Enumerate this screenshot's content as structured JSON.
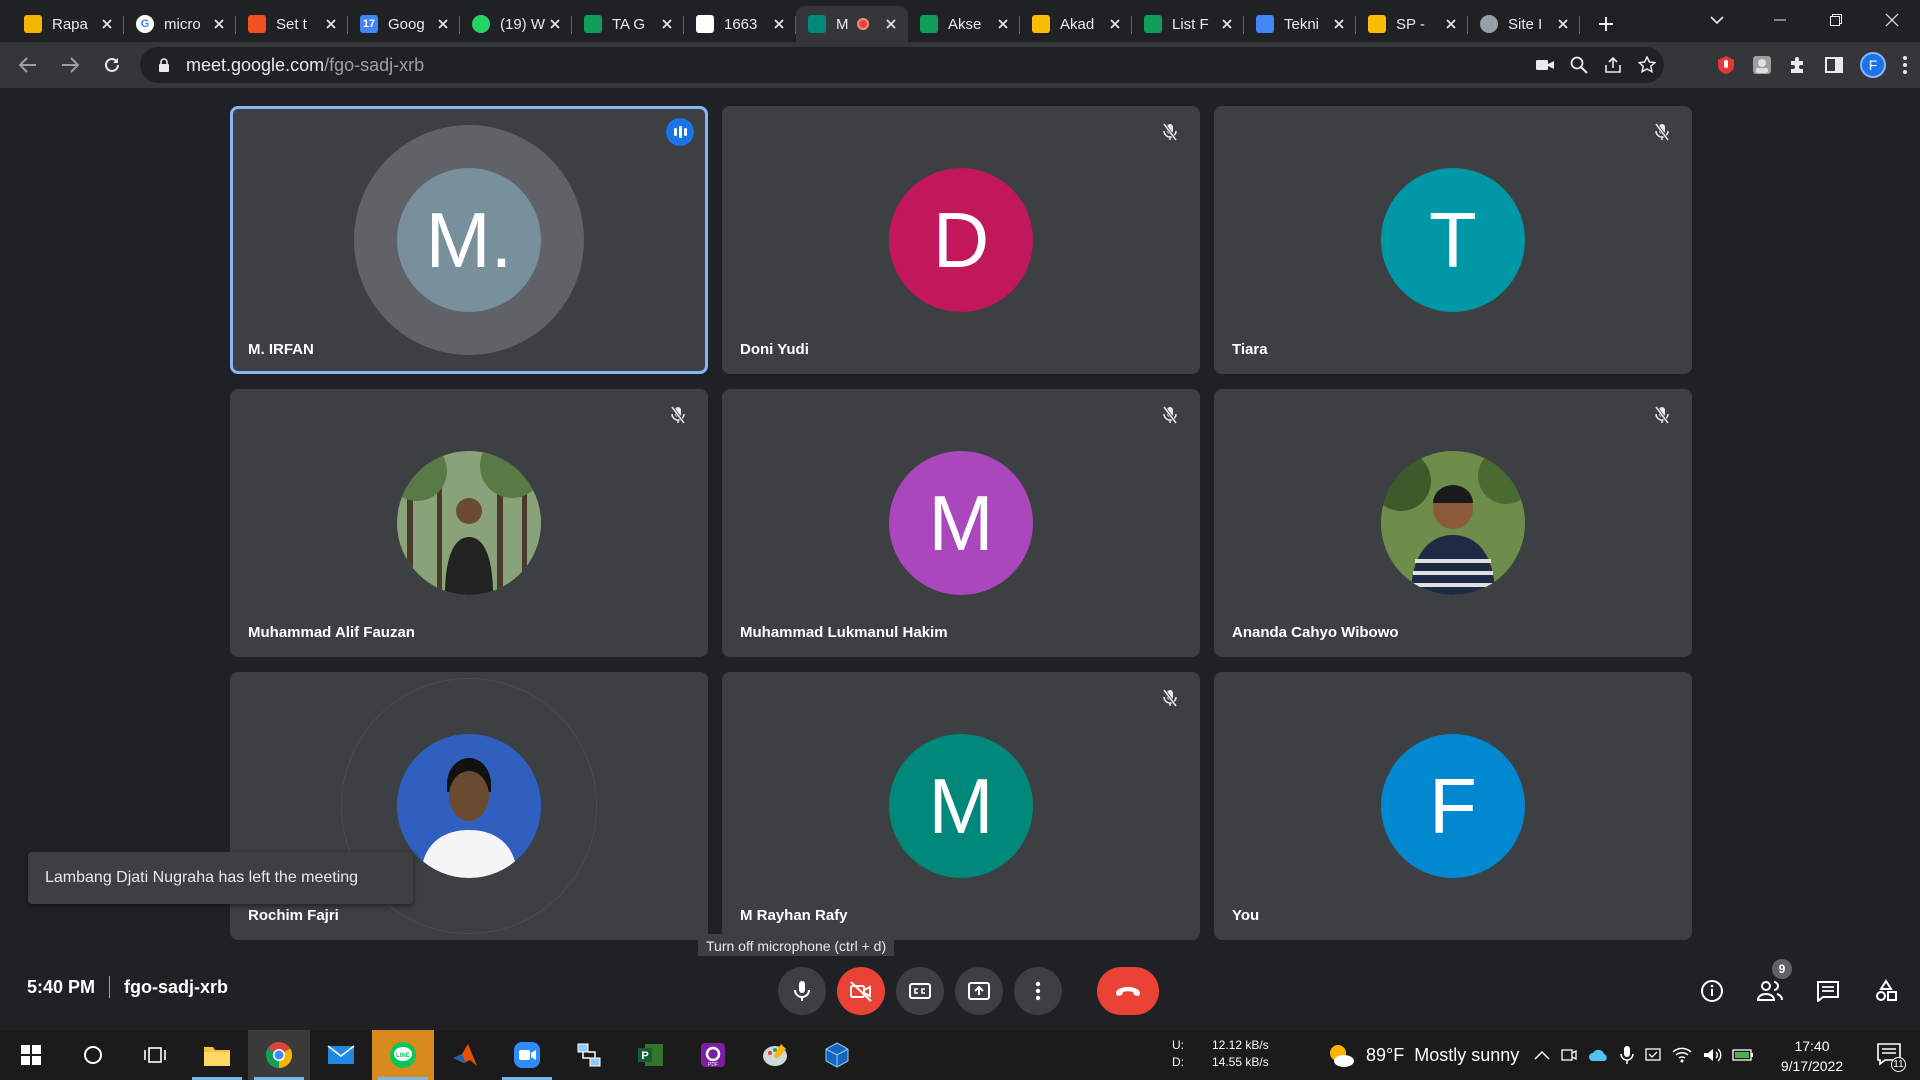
{
  "browser": {
    "tabs": [
      {
        "title": "Rapa",
        "icon": "slides-icon",
        "color": "#f4b400",
        "glyph": ""
      },
      {
        "title": "micro",
        "icon": "google-icon",
        "color": "#ffffff",
        "glyph": "G"
      },
      {
        "title": "Set t",
        "icon": "microsoft-icon",
        "color": "#f25022",
        "glyph": ""
      },
      {
        "title": "Goog",
        "icon": "calendar-icon",
        "color": "#4285f4",
        "glyph": "17"
      },
      {
        "title": "(19) W",
        "icon": "whatsapp-icon",
        "color": "#25d366",
        "glyph": ""
      },
      {
        "title": "TA G",
        "icon": "sheets-icon",
        "color": "#0f9d58",
        "glyph": ""
      },
      {
        "title": "1663",
        "icon": "pdf-icon",
        "color": "#ffffff",
        "glyph": ""
      },
      {
        "title": "M",
        "icon": "meet-icon",
        "color": "#00897b",
        "glyph": "",
        "active": true
      },
      {
        "title": "Akse",
        "icon": "sheets-icon",
        "color": "#0f9d58",
        "glyph": ""
      },
      {
        "title": "Akad",
        "icon": "drive-icon",
        "color": "#fbbc04",
        "glyph": ""
      },
      {
        "title": "List F",
        "icon": "sheets-icon",
        "color": "#0f9d58",
        "glyph": ""
      },
      {
        "title": "Tekni",
        "icon": "docs-icon",
        "color": "#4285f4",
        "glyph": ""
      },
      {
        "title": "SP -",
        "icon": "drive-icon",
        "color": "#fbbc04",
        "glyph": ""
      },
      {
        "title": "Site I",
        "icon": "globe-icon",
        "color": "#9aa0a6",
        "glyph": ""
      }
    ],
    "url_host": "meet.google.com",
    "url_path": "/fgo-sadj-xrb",
    "profile_initial": "F"
  },
  "meet": {
    "participants": [
      {
        "name": "M. IRFAN",
        "initial": "M.",
        "avatar_color": "#78909c",
        "photo": "",
        "muted": false,
        "speaking": true
      },
      {
        "name": "Doni Yudi",
        "initial": "D",
        "avatar_color": "#c2185b",
        "photo": "",
        "muted": true,
        "speaking": false
      },
      {
        "name": "Tiara",
        "initial": "T",
        "avatar_color": "#0097a7",
        "photo": "",
        "muted": true,
        "speaking": false
      },
      {
        "name": "Muhammad Alif Fauzan",
        "initial": "",
        "avatar_color": "#4a6b45",
        "photo": "trees",
        "muted": true,
        "speaking": false
      },
      {
        "name": "Muhammad Lukmanul Hakim",
        "initial": "M",
        "avatar_color": "#ab47bc",
        "photo": "",
        "muted": true,
        "speaking": false
      },
      {
        "name": "Ananda Cahyo Wibowo",
        "initial": "",
        "avatar_color": "#5b7a3a",
        "photo": "outdoor",
        "muted": true,
        "speaking": false
      },
      {
        "name": "Rochim Fajri",
        "initial": "",
        "avatar_color": "#2f5fbf",
        "photo": "blue",
        "muted": false,
        "speaking": false
      },
      {
        "name": "M Rayhan Rafy",
        "initial": "M",
        "avatar_color": "#00897b",
        "photo": "",
        "muted": true,
        "speaking": false
      },
      {
        "name": "You",
        "initial": "F",
        "avatar_color": "#0288d1",
        "photo": "",
        "muted": false,
        "speaking": false
      }
    ],
    "toast": "Lambang Djati Nugraha has left the meeting",
    "tooltip": "Turn off microphone (ctrl + d)",
    "time": "5:40 PM",
    "meeting_code": "fgo-sadj-xrb",
    "people_count": "9"
  },
  "taskbar": {
    "upload_label": "U:",
    "upload": "12.12 kB/s",
    "download_label": "D:",
    "download": "14.55 kB/s",
    "weather_temp": "89°F",
    "weather_text": "Mostly sunny",
    "clock_time": "17:40",
    "clock_date": "9/17/2022",
    "notifications": "11"
  }
}
